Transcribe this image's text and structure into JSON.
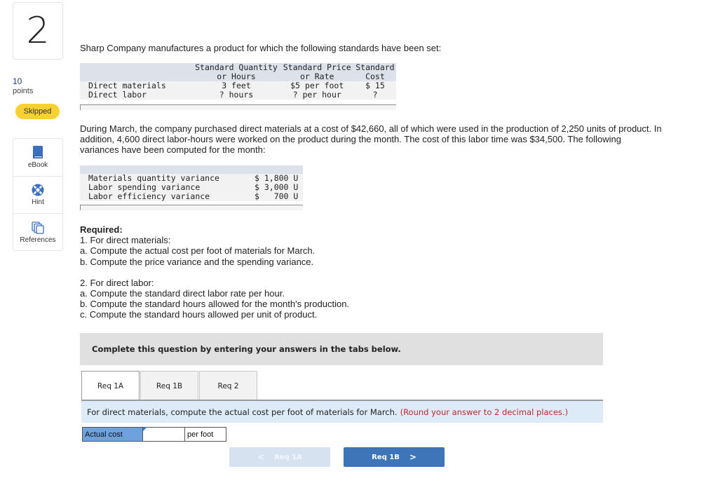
{
  "question": {
    "number": "2",
    "points_value": "10",
    "points_label": "points",
    "status": "Skipped"
  },
  "tools": [
    {
      "label": "eBook",
      "icon": "book-icon"
    },
    {
      "label": "Hint",
      "icon": "lifebuoy-icon"
    },
    {
      "label": "References",
      "icon": "stacked-pages-icon"
    }
  ],
  "colors": {
    "accent_blue": "#3d75b8",
    "skipped_badge": "#f7d132",
    "hint_red": "#c0282d",
    "prompt_bg": "#dcebf7",
    "answer_label_bg": "#6fa2dc"
  },
  "intro": "Sharp Company manufactures a product for which the following standards have been set:",
  "standards_table": {
    "headers": [
      [
        "",
        "Standard Quantity",
        "Standard Price",
        "Standard"
      ],
      [
        "",
        "or Hours",
        "or Rate",
        "Cost"
      ]
    ],
    "rows": [
      [
        "Direct materials",
        "3 feet",
        "$5 per foot",
        "$ 15"
      ],
      [
        "Direct labor",
        "? hours",
        "? per hour",
        "?"
      ]
    ]
  },
  "paragraph": "During March, the company purchased direct materials at a cost of $42,660, all of which were used in the production of 2,250 units of product. In addition, 4,600 direct labor-hours were worked on the product during the month. The cost of this labor time was $34,500. The following variances have been computed for the month:",
  "variances_table": {
    "rows": [
      [
        "Materials quantity variance",
        "$ 1,800 U"
      ],
      [
        "Labor spending variance",
        "$ 3,000 U"
      ],
      [
        "Labor efficiency variance",
        "$   700 U"
      ]
    ]
  },
  "required": {
    "title": "Required:",
    "part1": {
      "heading": "1. For direct materials:",
      "items": [
        "a. Compute the actual cost per foot of materials for March.",
        "b. Compute the price variance and the spending variance."
      ]
    },
    "part2": {
      "heading": "2. For direct labor:",
      "items": [
        "a. Compute the standard direct labor rate per hour.",
        "b. Compute the standard hours allowed for the month's production.",
        "c. Compute the standard hours allowed per unit of product."
      ]
    }
  },
  "instructions": "Complete this question by entering your answers in the tabs below.",
  "tabs": [
    {
      "label": "Req 1A",
      "active": true
    },
    {
      "label": "Req 1B",
      "active": false
    },
    {
      "label": "Req 2",
      "active": false
    }
  ],
  "prompt": {
    "text": "For direct materials, compute the actual cost per foot of materials for March.",
    "hint": "(Round your answer to 2 decimal places.)"
  },
  "answer": {
    "label": "Actual cost",
    "value": "",
    "unit": "per foot"
  },
  "navigation": {
    "prev_label": "Req 1A",
    "next_label": "Req 1B",
    "prev_chevron": "<",
    "next_chevron": ">"
  }
}
